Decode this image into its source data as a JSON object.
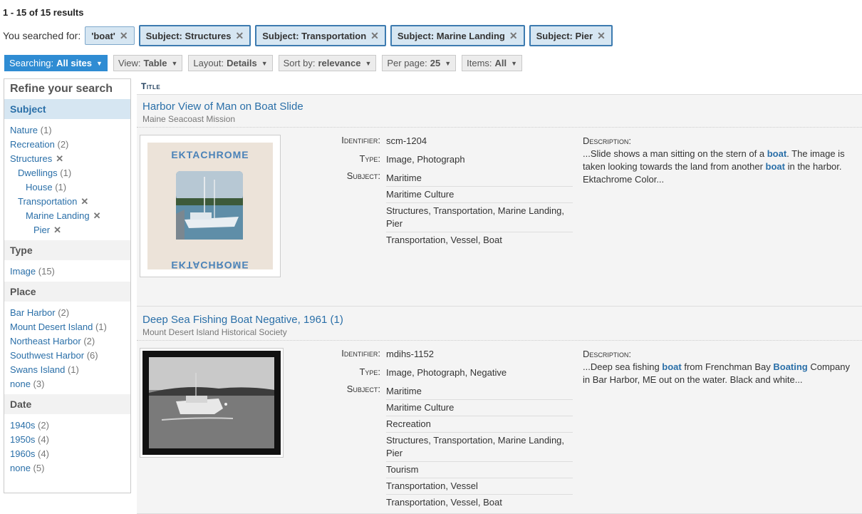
{
  "results_count": "1 - 15 of 15 results",
  "search": {
    "label": "You searched for:",
    "chips": [
      "'boat'",
      "Subject: Structures",
      "Subject: Transportation",
      "Subject: Marine Landing",
      "Subject: Pier"
    ]
  },
  "toolbar": {
    "searching": {
      "label": "Searching:",
      "value": "All sites"
    },
    "view": {
      "label": "View:",
      "value": "Table"
    },
    "layout": {
      "label": "Layout:",
      "value": "Details"
    },
    "sort": {
      "label": "Sort by:",
      "value": "relevance"
    },
    "per_page": {
      "label": "Per page:",
      "value": "25"
    },
    "items": {
      "label": "Items:",
      "value": "All"
    }
  },
  "sidebar": {
    "title": "Refine your search",
    "subject": {
      "heading": "Subject",
      "items": [
        {
          "label": "Nature",
          "count": "(1)"
        },
        {
          "label": "Recreation",
          "count": "(2)"
        },
        {
          "label": "Structures"
        },
        {
          "label": "Dwellings",
          "count": "(1)"
        },
        {
          "label": "House",
          "count": "(1)"
        },
        {
          "label": "Transportation"
        },
        {
          "label": "Marine Landing"
        },
        {
          "label": "Pier"
        }
      ]
    },
    "type": {
      "heading": "Type",
      "items": [
        {
          "label": "Image",
          "count": "(15)"
        }
      ]
    },
    "place": {
      "heading": "Place",
      "items": [
        {
          "label": "Bar Harbor",
          "count": "(2)"
        },
        {
          "label": "Mount Desert Island",
          "count": "(1)"
        },
        {
          "label": "Northeast Harbor",
          "count": "(2)"
        },
        {
          "label": "Southwest Harbor",
          "count": "(6)"
        },
        {
          "label": "Swans Island",
          "count": "(1)"
        },
        {
          "label": "none",
          "count": "(3)"
        }
      ]
    },
    "date": {
      "heading": "Date",
      "items": [
        {
          "label": "1940s",
          "count": "(2)"
        },
        {
          "label": "1950s",
          "count": "(4)"
        },
        {
          "label": "1960s",
          "count": "(4)"
        },
        {
          "label": "none",
          "count": "(5)"
        }
      ]
    }
  },
  "table": {
    "column_title": "Title"
  },
  "records": [
    {
      "title": "Harbor View of Man on Boat Slide",
      "owner": "Maine Seacoast Mission",
      "labels": {
        "identifier": "Identifier:",
        "type": "Type:",
        "subject": "Subject:",
        "description": "Description:"
      },
      "identifier": "scm-1204",
      "type": "Image, Photograph",
      "subjects": [
        "Maritime",
        "Maritime Culture",
        "Structures, Transportation, Marine Landing, Pier",
        "Transportation, Vessel, Boat"
      ],
      "description_parts": [
        "...Slide shows a man sitting on the stern of a ",
        "boat",
        ". The image is taken looking towards the land from another ",
        "boat",
        " in the harbor. Ektachrome Color..."
      ],
      "slide_text": "EKTACHROME"
    },
    {
      "title": "Deep Sea Fishing Boat Negative, 1961 (1)",
      "owner": "Mount Desert Island Historical Society",
      "labels": {
        "identifier": "Identifier:",
        "type": "Type:",
        "subject": "Subject:",
        "description": "Description:"
      },
      "identifier": "mdihs-1152",
      "type": "Image, Photograph, Negative",
      "subjects": [
        "Maritime",
        "Maritime Culture",
        "Recreation",
        "Structures, Transportation, Marine Landing, Pier",
        "Tourism",
        "Transportation, Vessel",
        "Transportation, Vessel, Boat"
      ],
      "description_parts": [
        "...Deep sea fishing ",
        "boat",
        " from Frenchman Bay ",
        "Boating",
        " Company in Bar Harbor, ME out on the water. Black and white..."
      ]
    }
  ]
}
